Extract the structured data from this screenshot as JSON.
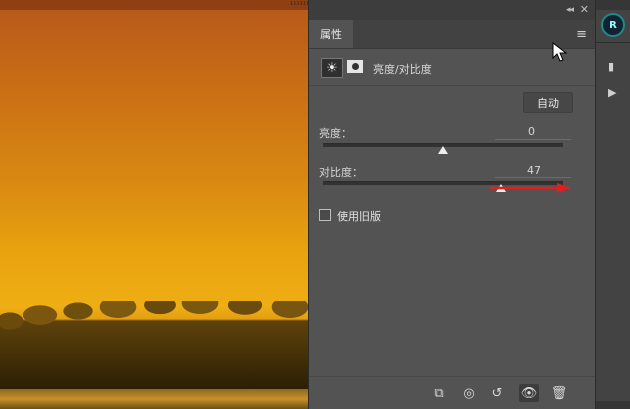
{
  "canvas": {
    "top_marks": "¹¹¹¹¹¹¹¹ ³²²"
  },
  "panel": {
    "tab_label": "属性",
    "title": "亮度/对比度",
    "auto_label": "自动",
    "brightness": {
      "label": "亮度：",
      "value": "0",
      "slider_fraction": 0.5
    },
    "contrast": {
      "label": "对比度：",
      "value": "47",
      "slider_fraction": 0.74
    },
    "legacy_label": "使用旧版",
    "legacy_checked": false
  },
  "dock": {
    "logo_text": "R",
    "item1": "▮",
    "item2": "▶"
  },
  "icons": {
    "adjustment": "sun-icon",
    "mask": "mask-icon",
    "clip": "clip-to-layer-icon",
    "view_previous": "view-previous-state-icon",
    "reset": "reset-icon",
    "visibility": "eye-icon",
    "delete": "trash-icon"
  },
  "colors": {
    "panel_bg": "#535353",
    "arrow": "#e21f1f"
  }
}
